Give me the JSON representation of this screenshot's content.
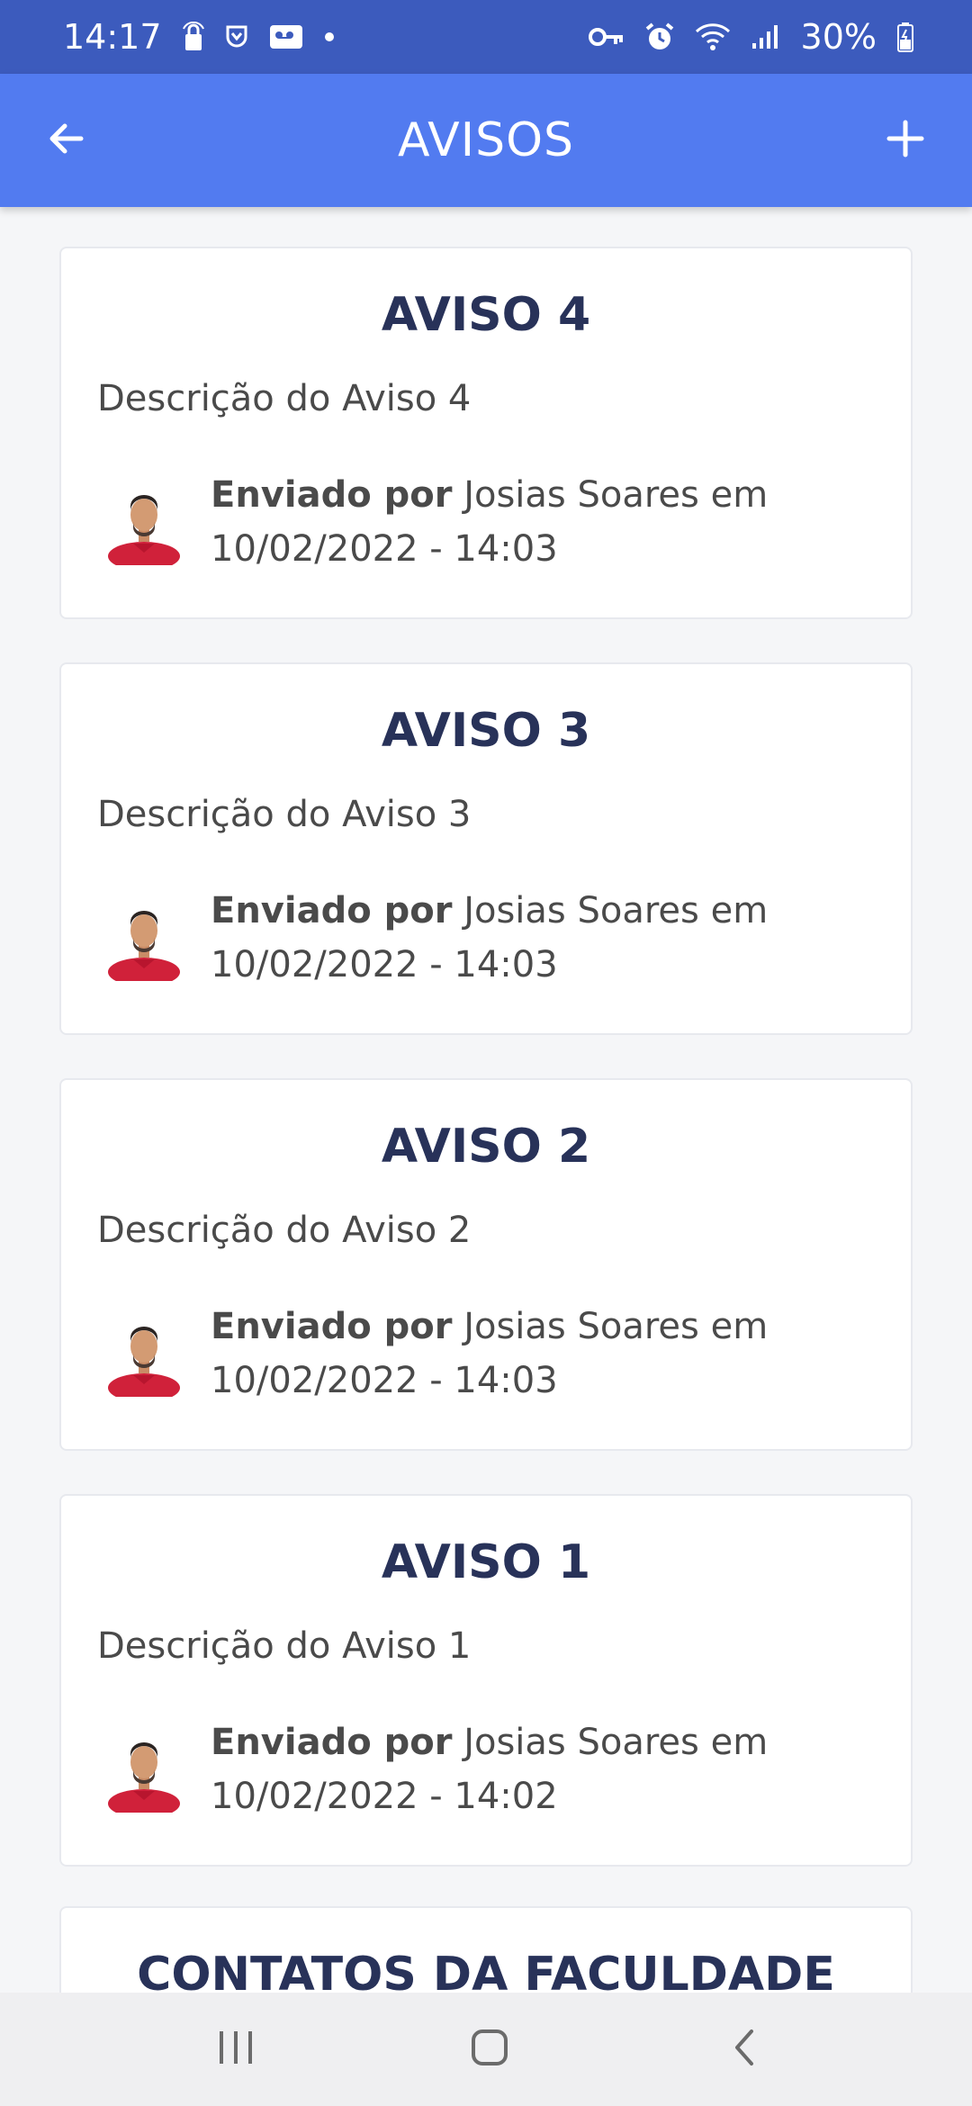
{
  "status_bar": {
    "time": "14:17",
    "battery": "30%"
  },
  "app_bar": {
    "title": "AVISOS"
  },
  "notices": [
    {
      "title": "AVISO 4",
      "description": "Descrição do Aviso 4",
      "sent_by_label": "Enviado por",
      "author": "Josias Soares",
      "at_label": "em",
      "datetime": "10/02/2022 - 14:03"
    },
    {
      "title": "AVISO 3",
      "description": "Descrição do Aviso 3",
      "sent_by_label": "Enviado por",
      "author": "Josias Soares",
      "at_label": "em",
      "datetime": "10/02/2022 - 14:03"
    },
    {
      "title": "AVISO 2",
      "description": "Descrição do Aviso 2",
      "sent_by_label": "Enviado por",
      "author": "Josias Soares",
      "at_label": "em",
      "datetime": "10/02/2022 - 14:03"
    },
    {
      "title": "AVISO 1",
      "description": "Descrição do Aviso 1",
      "sent_by_label": "Enviado por",
      "author": "Josias Soares",
      "at_label": "em",
      "datetime": "10/02/2022 - 14:02"
    }
  ],
  "contacts_section": {
    "title": "CONTATOS DA FACULDADE"
  },
  "icons": {
    "back": "arrow-left-icon",
    "add": "plus-icon",
    "recents": "recents-icon",
    "home": "home-icon",
    "nav_back": "chevron-left-icon"
  },
  "colors": {
    "status_bar": "#3c5bbd",
    "app_bar": "#527bf0",
    "title_text": "#283259",
    "body_text": "#4a4a4a",
    "background": "#f5f6f8"
  }
}
